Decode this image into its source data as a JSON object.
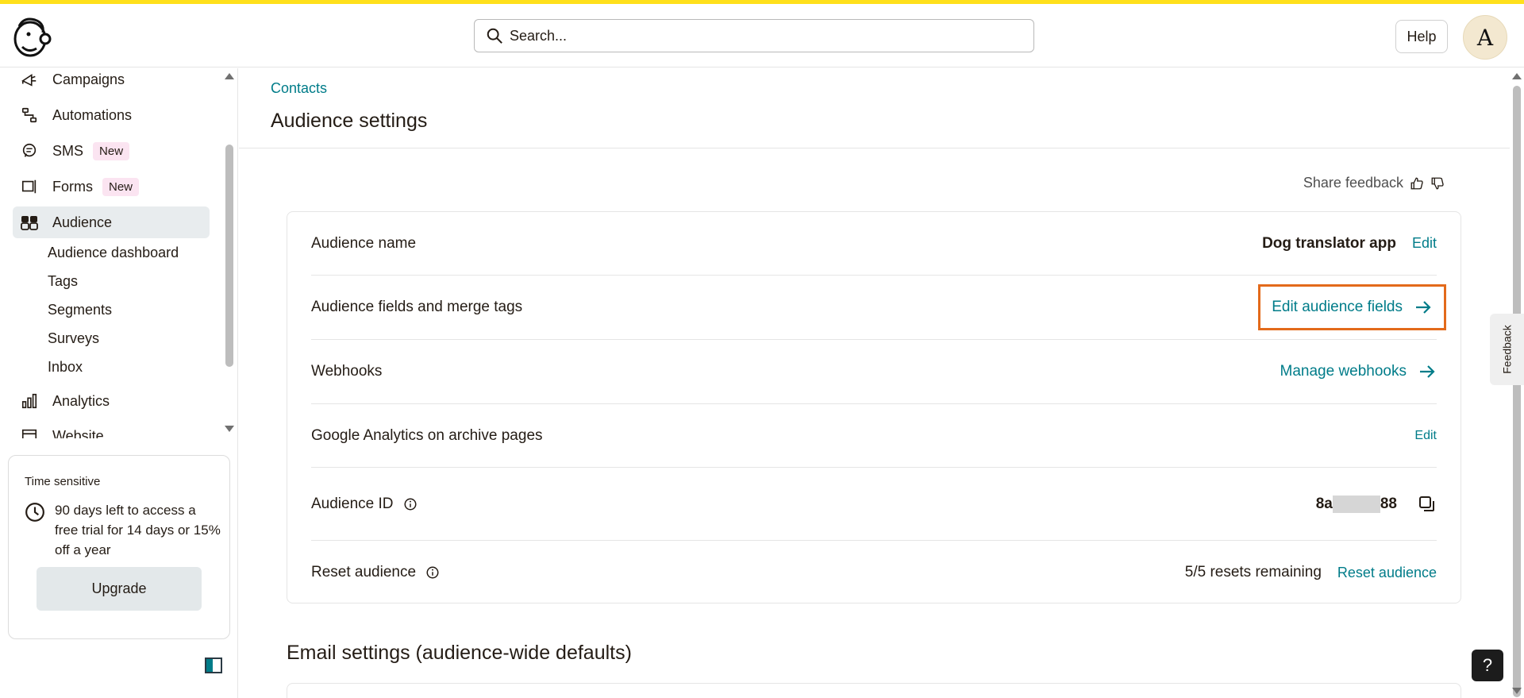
{
  "search": {
    "placeholder": "Search..."
  },
  "header": {
    "help_label": "Help",
    "avatar_initial": "A"
  },
  "sidebar": {
    "items": [
      {
        "label": "Campaigns",
        "icon": "megaphone-icon"
      },
      {
        "label": "Automations",
        "icon": "automations-icon"
      },
      {
        "label": "SMS",
        "icon": "sms-icon",
        "badge": "New"
      },
      {
        "label": "Forms",
        "icon": "forms-icon",
        "badge": "New"
      },
      {
        "label": "Audience",
        "icon": "audience-icon",
        "active": true
      },
      {
        "label": "Analytics",
        "icon": "analytics-icon"
      },
      {
        "label": "Website",
        "icon": "website-icon"
      }
    ],
    "audience_sub": [
      "Audience dashboard",
      "Tags",
      "Segments",
      "Surveys",
      "Inbox"
    ]
  },
  "promo": {
    "title": "Time sensitive",
    "text": "90 days left to access a free trial for 14 days or 15% off a year",
    "upgrade_label": "Upgrade"
  },
  "main": {
    "breadcrumb": "Contacts",
    "title": "Audience settings",
    "share_feedback": "Share feedback",
    "rows": [
      {
        "label": "Audience name",
        "value": "Dog translator app",
        "action": "Edit"
      },
      {
        "label": "Audience fields and merge tags",
        "action": "Edit audience fields"
      },
      {
        "label": "Webhooks",
        "action": "Manage webhooks"
      },
      {
        "label": "Google Analytics on archive pages",
        "action": "Edit"
      },
      {
        "label": "Audience ID",
        "value_prefix": "8a",
        "value_suffix": "88"
      },
      {
        "label": "Reset audience",
        "value": "5/5 resets remaining",
        "action": "Reset audience"
      }
    ],
    "email_settings_title": "Email settings (audience-wide defaults)"
  },
  "feedback_tab": "Feedback",
  "help_fab": "?",
  "colors": {
    "accent": "#007c89",
    "brand_yellow": "#ffe01b",
    "highlight": "#e36a1b",
    "badge_bg": "#fbe4f1"
  }
}
